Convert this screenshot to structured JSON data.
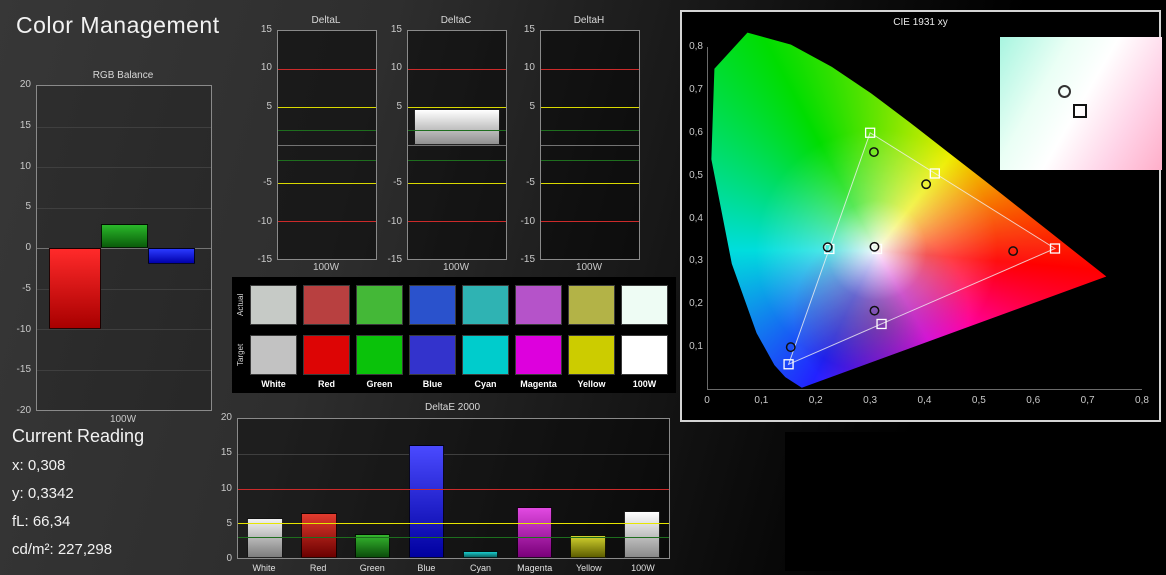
{
  "app": {
    "title": "Color Management"
  },
  "current_reading": {
    "heading": "Current Reading",
    "lines": [
      "x: 0,308",
      "y: 0,3342",
      "fL: 66,34",
      "cd/m²: 227,298"
    ]
  },
  "swatches": {
    "row_labels": [
      "Actual",
      "Target"
    ],
    "columns": [
      "White",
      "Red",
      "Green",
      "Blue",
      "Cyan",
      "Magenta",
      "Yellow",
      "100W"
    ],
    "actual_colors": [
      "#c6cac6",
      "#b84040",
      "#44b837",
      "#2a52cc",
      "#2fb3b3",
      "#b553c9",
      "#b3b347",
      "#eefcf4"
    ],
    "target_colors": [
      "#c2c2c2",
      "#dd0505",
      "#0ac20a",
      "#3333cc",
      "#00cccc",
      "#dd00dd",
      "#cccc00",
      "#ffffff"
    ]
  },
  "chart_data": [
    {
      "id": "rgb_balance",
      "type": "bar",
      "title": "RGB Balance",
      "xlabel": "100W",
      "ylim": [
        -20,
        20
      ],
      "yticks": [
        20,
        15,
        10,
        5,
        0,
        -5,
        -10,
        -15,
        -20
      ],
      "categories": [
        "Red",
        "Green",
        "Blue"
      ],
      "values": [
        -10,
        3,
        -2
      ],
      "bar_colors": [
        [
          "#ff2a2a",
          "#a80000"
        ],
        [
          "#2ab82a",
          "#0a5c0a"
        ],
        [
          "#2a3aff",
          "#0000aa"
        ]
      ],
      "slots": [
        [
          7,
          30
        ],
        [
          37,
          27
        ],
        [
          64,
          27
        ]
      ]
    },
    {
      "id": "deltaL",
      "type": "bar",
      "title": "DeltaL",
      "xlabel": "100W",
      "ylim": [
        -15,
        15
      ],
      "yticks": [
        15,
        10,
        5,
        -5,
        -10,
        -15
      ],
      "categories": [
        "100W"
      ],
      "values": [
        null
      ],
      "bar_colors": [
        [
          "#ffffff",
          "#909090"
        ]
      ],
      "slots": [
        [
          6,
          88
        ]
      ],
      "ref_lines": [
        {
          "y": 10,
          "color": "#cc2a2a"
        },
        {
          "y": 5,
          "color": "#d9d900"
        },
        {
          "y": 2,
          "color": "#1e6e1e"
        },
        {
          "y": -2,
          "color": "#1e6e1e"
        },
        {
          "y": -5,
          "color": "#d9d900"
        },
        {
          "y": -10,
          "color": "#cc2a2a"
        }
      ]
    },
    {
      "id": "deltaC",
      "type": "bar",
      "title": "DeltaC",
      "xlabel": "100W",
      "ylim": [
        -15,
        15
      ],
      "yticks": [
        15,
        10,
        5,
        -5,
        -10,
        -15
      ],
      "categories": [
        "100W"
      ],
      "values": [
        4.7
      ],
      "bar_colors": [
        [
          "#ffffff",
          "#909090"
        ]
      ],
      "slots": [
        [
          6,
          88
        ]
      ],
      "ref_lines": [
        {
          "y": 10,
          "color": "#cc2a2a"
        },
        {
          "y": 5,
          "color": "#d9d900"
        },
        {
          "y": 2,
          "color": "#1e6e1e"
        },
        {
          "y": -2,
          "color": "#1e6e1e"
        },
        {
          "y": -5,
          "color": "#d9d900"
        },
        {
          "y": -10,
          "color": "#cc2a2a"
        }
      ]
    },
    {
      "id": "deltaH",
      "type": "bar",
      "title": "DeltaH",
      "xlabel": "100W",
      "ylim": [
        -15,
        15
      ],
      "yticks": [
        15,
        10,
        5,
        -5,
        -10,
        -15
      ],
      "categories": [
        "100W"
      ],
      "values": [
        null
      ],
      "bar_colors": [
        [
          "#ffffff",
          "#909090"
        ]
      ],
      "slots": [
        [
          6,
          88
        ]
      ],
      "ref_lines": [
        {
          "y": 10,
          "color": "#cc2a2a"
        },
        {
          "y": 5,
          "color": "#d9d900"
        },
        {
          "y": 2,
          "color": "#1e6e1e"
        },
        {
          "y": -2,
          "color": "#1e6e1e"
        },
        {
          "y": -5,
          "color": "#d9d900"
        },
        {
          "y": -10,
          "color": "#cc2a2a"
        }
      ]
    },
    {
      "id": "deltaE",
      "type": "bar",
      "title": "DeltaE 2000",
      "ylim": [
        0,
        20
      ],
      "yticks": [
        20,
        15,
        10,
        5,
        0
      ],
      "categories": [
        "White",
        "Red",
        "Green",
        "Blue",
        "Cyan",
        "Magenta",
        "Yellow",
        "100W"
      ],
      "values": [
        5.8,
        6.5,
        3.5,
        16.2,
        1.0,
        7.3,
        3.3,
        6.7
      ],
      "bar_colors": [
        [
          "#f2f2f2",
          "#7d7d7d"
        ],
        [
          "#e23b2e",
          "#6b0000"
        ],
        [
          "#35b82e",
          "#0b4d0b"
        ],
        [
          "#4a4aff",
          "#0000a0"
        ],
        [
          "#19cccc",
          "#0a6666"
        ],
        [
          "#e24ae2",
          "#7a007a"
        ],
        [
          "#d2d22e",
          "#5e5e00"
        ],
        [
          "#ffffff",
          "#8a8a8a"
        ]
      ],
      "ref_lines": [
        {
          "y": 10,
          "color": "#cc2a2a"
        },
        {
          "y": 5,
          "color": "#e6e600"
        },
        {
          "y": 3,
          "color": "#1e6e1e"
        }
      ],
      "show_category_labels": true
    },
    {
      "id": "cie",
      "type": "scatter",
      "title": "CIE 1931 xy",
      "xlim": [
        0,
        0.8
      ],
      "ylim": [
        0,
        0.8
      ],
      "xticks": [
        "0",
        "0,1",
        "0,2",
        "0,3",
        "0,4",
        "0,5",
        "0,6",
        "0,7",
        "0,8"
      ],
      "yticks": [
        "0,8",
        "0,7",
        "0,6",
        "0,5",
        "0,4",
        "0,3",
        "0,2",
        "0,1"
      ],
      "gamut_triangle": [
        [
          0.64,
          0.33
        ],
        [
          0.3,
          0.6
        ],
        [
          0.15,
          0.06
        ]
      ],
      "points": [
        {
          "name": "white",
          "target": [
            0.3127,
            0.329
          ],
          "measured": [
            0.308,
            0.334
          ]
        },
        {
          "name": "red",
          "target": [
            0.64,
            0.33
          ],
          "measured": [
            0.563,
            0.324
          ]
        },
        {
          "name": "green",
          "target": [
            0.3,
            0.6
          ],
          "measured": [
            0.307,
            0.555
          ]
        },
        {
          "name": "blue",
          "target": [
            0.15,
            0.06
          ],
          "measured": [
            0.154,
            0.1
          ]
        },
        {
          "name": "cyan",
          "target": [
            0.225,
            0.329
          ],
          "measured": [
            0.222,
            0.333
          ]
        },
        {
          "name": "magenta",
          "target": [
            0.321,
            0.154
          ],
          "measured": [
            0.308,
            0.185
          ]
        },
        {
          "name": "yellow",
          "target": [
            0.419,
            0.505
          ],
          "measured": [
            0.403,
            0.48
          ]
        }
      ]
    }
  ]
}
